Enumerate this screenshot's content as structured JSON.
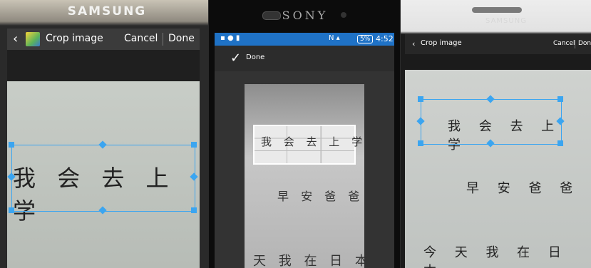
{
  "panels": [
    {
      "brand": "SAMSUNG",
      "header": {
        "title": "Crop image",
        "cancel": "Cancel",
        "done": "Done"
      },
      "text_lines": [
        "我 会 去 上 学"
      ]
    },
    {
      "brand": "SONY",
      "status": {
        "battery": "5%",
        "time": "4:52"
      },
      "header": {
        "done": "Done"
      },
      "text_lines": [
        "我 会 去 上 学",
        "早 安 爸 爸",
        "天 我 在 日 本"
      ]
    },
    {
      "brand": "SAMSUNG",
      "header": {
        "title": "Crop image",
        "cancel": "Cancel",
        "done": "Done"
      },
      "text_lines": [
        "我 会 去 上 学",
        "早 安 爸 爸",
        "今 天 我 在 日 本"
      ]
    }
  ],
  "colors": {
    "crop_handle": "#3ba5f0",
    "sony_status_bar": "#1f72c6"
  }
}
